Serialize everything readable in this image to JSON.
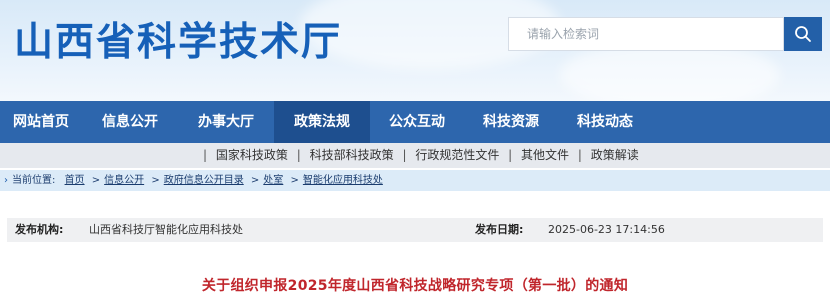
{
  "header": {
    "site_title": "山西省科学技术厅",
    "search_placeholder": "请输入检索词"
  },
  "nav": {
    "items": [
      {
        "label": "网站首页",
        "active": false
      },
      {
        "label": "信息公开",
        "active": false
      },
      {
        "label": "办事大厅",
        "active": false
      },
      {
        "label": "政策法规",
        "active": true
      },
      {
        "label": "公众互动",
        "active": false
      },
      {
        "label": "科技资源",
        "active": false
      },
      {
        "label": "科技动态",
        "active": false
      }
    ]
  },
  "subnav": {
    "items": [
      "国家科技政策",
      "科技部科技政策",
      "行政规范性文件",
      "其他文件",
      "政策解读"
    ]
  },
  "breadcrumb": {
    "prefix": "当前位置:",
    "items": [
      "首页",
      "信息公开",
      "政府信息公开目录",
      "处室",
      "智能化应用科技处"
    ]
  },
  "meta": {
    "publisher_label": "发布机构:",
    "publisher_value": "山西省科技厅智能化应用科技处",
    "date_label": "发布日期:",
    "date_value": "2025-06-23 17:14:56"
  },
  "article": {
    "title": "关于组织申报2025年度山西省科技战略研究专项（第一批）的通知"
  },
  "colors": {
    "brand_blue": "#1660b8",
    "nav_bg": "#2d66ad",
    "nav_active": "#1e4f8f",
    "title_red": "#c0262c"
  }
}
